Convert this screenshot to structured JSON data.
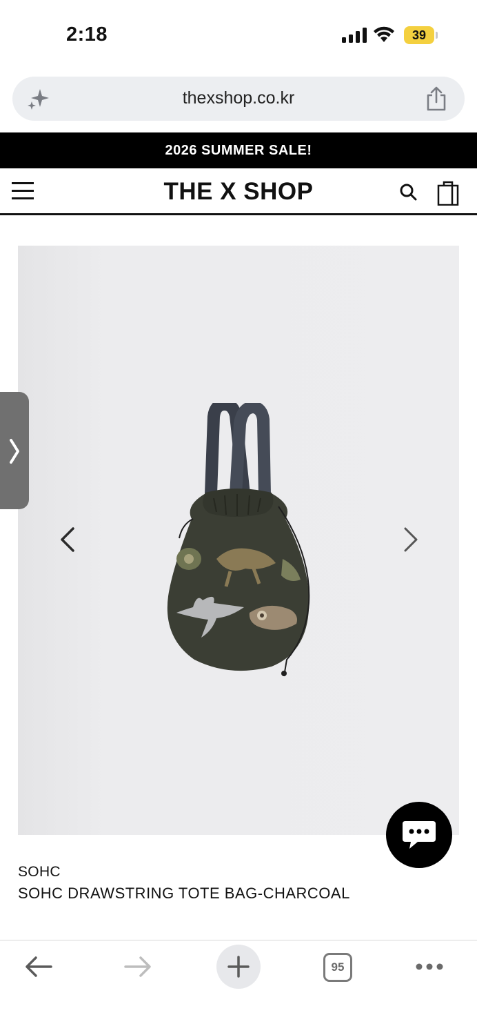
{
  "status_bar": {
    "time": "2:18",
    "battery": "39",
    "icons": [
      "cellular-signal-icon",
      "wifi-icon",
      "battery-icon"
    ]
  },
  "browser": {
    "url": "thexshop.co.kr",
    "icons": [
      "sparkle-icon",
      "share-icon"
    ]
  },
  "promo": {
    "text": "2026 SUMMER SALE!"
  },
  "header": {
    "logo": "THE X SHOP",
    "icons": [
      "menu-icon",
      "search-icon",
      "shopping-bag-icon"
    ]
  },
  "gallery": {
    "icons": [
      "chevron-left-icon",
      "chevron-right-icon"
    ],
    "image": "drawstring-tote-bag"
  },
  "product": {
    "brand": "SOHC",
    "name": "SOHC DRAWSTRING TOTE BAG-CHARCOAL"
  },
  "toolbar": {
    "tab_count": "95",
    "icons": [
      "back-arrow-icon",
      "forward-arrow-icon",
      "plus-icon",
      "tabs-icon",
      "more-icon"
    ]
  },
  "colors": {
    "banner_bg": "#000000",
    "gallery_bg": "#ededef",
    "battery": "#f4d03f",
    "chat_bg": "#000000"
  }
}
